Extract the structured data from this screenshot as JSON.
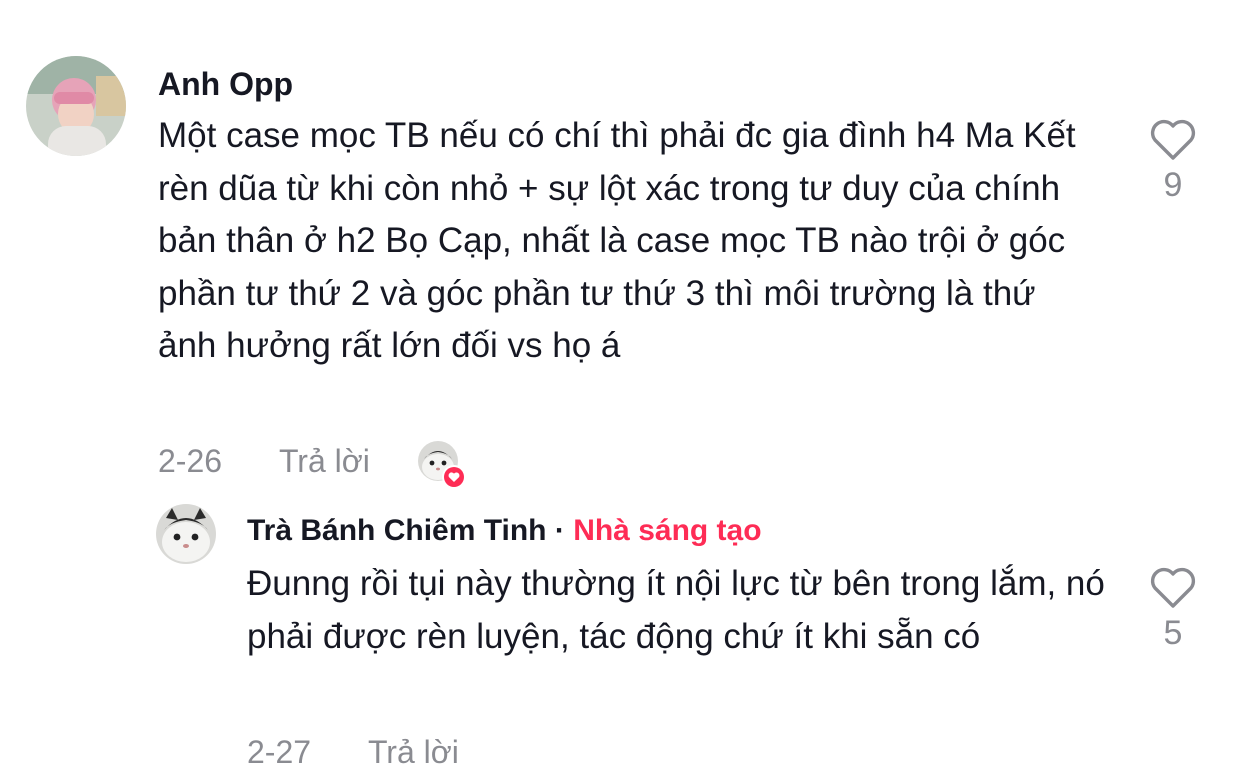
{
  "comments": [
    {
      "username": "Anh Opp",
      "text": "Một case mọc TB nếu có chí thì phải đc gia đình h4 Ma Kết rèn dũa từ khi còn nhỏ + sự lột xác trong tư duy của chính bản thân ở h2 Bọ Cạp, nhất là case mọc TB nào trội ở góc phần tư thứ 2 và góc phần tư thứ 3 thì môi trường là thứ ảnh hưởng rất lớn đối vs họ á",
      "date": "2-26",
      "reply_label": "Trả lời",
      "likes": "9"
    },
    {
      "username": "Trà Bánh Chiêm Tinh",
      "separator": "·",
      "creator_label": "Nhà sáng tạo",
      "text": "Đunng rồi tụi này thường ít nội lực từ bên trong lắm, nó phải được rèn luyện, tác động chứ ít khi sẵn có",
      "date": "2-27",
      "reply_label": "Trả lời",
      "likes": "5"
    }
  ],
  "colors": {
    "creator": "#fe2c55",
    "text": "#161823",
    "muted": "#8a8b91",
    "heart_badge": "#fe2c55"
  },
  "icons": {
    "like": "heart-outline-icon",
    "creator_liked_badge": "heart-badge-icon"
  }
}
